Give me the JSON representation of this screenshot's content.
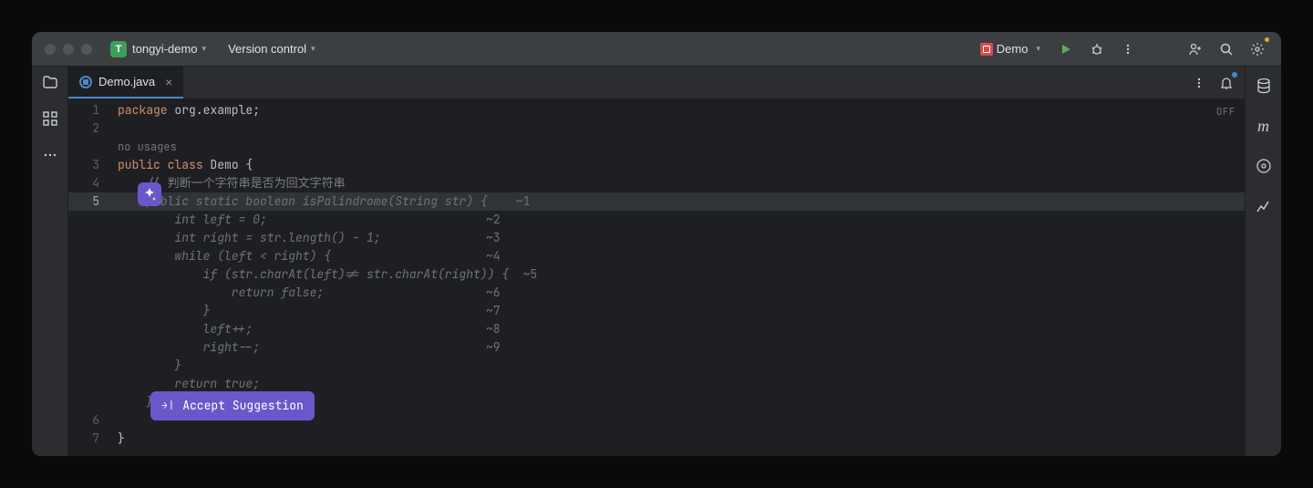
{
  "titlebar": {
    "project_letter": "T",
    "project_name": "tongyi-demo",
    "version_control_label": "Version control",
    "run_config": "Demo"
  },
  "tab": {
    "filename": "Demo.java"
  },
  "editor": {
    "off_badge": "OFF",
    "hint_text": "no usages",
    "line1": {
      "pkg": "package",
      "rest": " org.example;"
    },
    "line3": {
      "pub": "public",
      "cls": " class",
      "rest": " Demo {"
    },
    "line4_comment": "    // 判断一个字符串是否为回文字符串",
    "ghost": {
      "l5": "    public static boolean isPalindrome(String str) {",
      "l5m": "    ~1",
      "l6": "        int left = 0;",
      "l6m": "~2",
      "l7": "        int right = str.length() - 1;",
      "l7m": "~3",
      "l8": "        while (left < right) {",
      "l8m": "~4",
      "l9": "            if (str.charAt(left)!= str.charAt(right)) {",
      "l9m": "  ~5",
      "l10": "                return false;",
      "l10m": "~6",
      "l11": "            }",
      "l11m": "~7",
      "l12": "            left++;",
      "l12m": "~8",
      "l13": "            right--;",
      "l13m": "~9",
      "l14": "        }",
      "l15": "        return true;",
      "l16": "    }"
    },
    "line7": "}"
  },
  "gutter": {
    "l1": "1",
    "l2": "2",
    "l3": "3",
    "l4": "4",
    "l5": "5",
    "l6": "6",
    "l7": "7"
  },
  "accept": {
    "tab_glyph": "→|",
    "label": "Accept Suggestion"
  }
}
